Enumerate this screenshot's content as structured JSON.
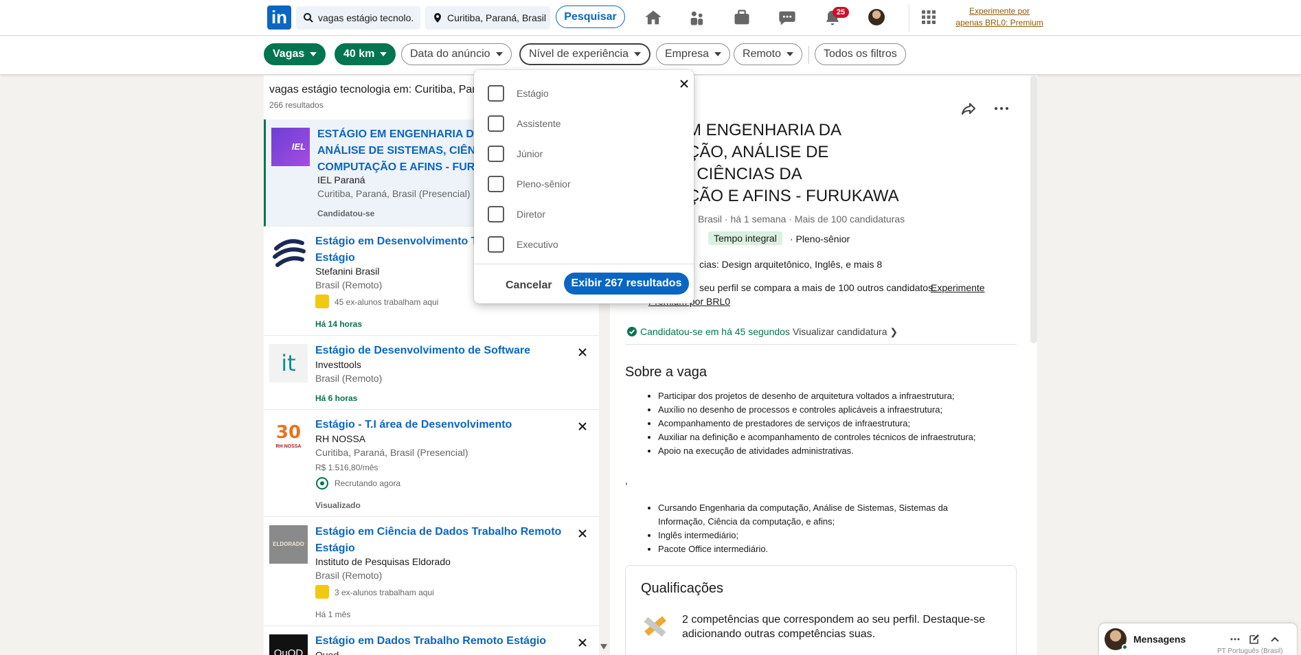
{
  "nav": {
    "search_query": "vagas estágio tecnolo...",
    "location": "Curitiba, Paraná, Brasil",
    "search_button": "Pesquisar",
    "notifications_count": "25",
    "premium_line1": "Experimente por",
    "premium_line2": "apenas BRL0: Premium",
    "logo_text": "in"
  },
  "filters": {
    "vagas": "Vagas",
    "distance": "40 km",
    "date": "Data do anúncio",
    "experience": "Nível de experiência",
    "company": "Empresa",
    "remote": "Remoto",
    "all": "Todos os filtros"
  },
  "results": {
    "heading": "vagas estágio tecnologia em: Curitiba, Paraná",
    "count": "266 resultados",
    "jobs": [
      {
        "title": "ESTÁGIO EM ENGENHARIA DA COMPUTAÇÃO, ANÁLISE DE SISTEMAS, CIÊNCIAS DA COMPUTAÇÃO E AFINS - FURUKAWA",
        "company": "IEL Paraná",
        "location": "Curitiba, Paraná, Brasil (Presencial)",
        "meta": "",
        "footer": "Candidatou-se"
      },
      {
        "title": "Estágio em Desenvolvimento Trabalho Remoto Estágio",
        "company": "Stefanini Brasil",
        "location": "Brasil (Remoto)",
        "meta": "45 ex-alunos trabalham aqui",
        "footer": "Há 14 horas"
      },
      {
        "title": "Estágio de Desenvolvimento de Software",
        "company": "Investtools",
        "location": "Brasil (Remoto)",
        "meta": "",
        "footer": "Há 6 horas"
      },
      {
        "title": "Estágio - T.I área de Desenvolvimento",
        "company": "RH NOSSA",
        "location": "Curitiba, Paraná, Brasil (Presencial)",
        "salary": "R$ 1.516,80/mês",
        "meta": "Recrutando agora",
        "footer": "Visualizado"
      },
      {
        "title": "Estágio em Ciência de Dados Trabalho Remoto Estágio",
        "company": "Instituto de Pesquisas Eldorado",
        "location": "Brasil (Remoto)",
        "meta": "3 ex-alunos trabalham aqui",
        "footer": "Há 1 mês"
      },
      {
        "title": "Estágio em Dados Trabalho Remoto Estágio",
        "company": "Quod",
        "location": "",
        "meta": "",
        "footer": ""
      }
    ]
  },
  "logos": {
    "iel": "IEL",
    "it": "it",
    "rh": "RH NOSSA",
    "eldorado": "ELDORADO",
    "quod": "QuOD"
  },
  "detail": {
    "company_fragment": "á",
    "title_lines": [
      "EM ENGENHARIA DA",
      "AÇÃO, ANÁLISE DE",
      "S, CIÊNCIAS DA",
      "AÇÃO E AFINS - FURUKAWA"
    ],
    "meta": "Brasil · há 1 semana · Mais de 100 candidaturas",
    "tag_full_time": "Tempo integral",
    "level": "· Pleno-sênior",
    "skills": "cias: Design arquitetônico, Inglês, e mais 8",
    "compare_text": "seu perfil se compara a mais de 100 outros candidatos.",
    "compare_link1": "Experimente",
    "compare_link2": "Premium por BRL0",
    "applied": "Candidatou-se em há 45 segundos",
    "view_application": "Visualizar candidatura",
    "about_heading": "Sobre a vaga",
    "bullets1": [
      "Participar dos projetos de desenho de arquitetura voltados a infraestrutura;",
      "Auxílio no desenho de processos e controles aplicáveis a infraestrutura;",
      "Acompanhamento de prestadores de serviços de infraestrutura;",
      "Auxiliar na definição e acompanhamento de controles técnicos de infraestrutura;",
      "Apoio na execução de atividades administrativas."
    ],
    "stray": ",",
    "bullets2": [
      "Cursando Engenharia da computação, Análise de Sistemas, Sistemas da Informação, Ciência da computação, e afins;",
      "Inglês intermediário;",
      "Pacote Office intermediário."
    ],
    "qual_heading": "Qualificações",
    "qual_text": "2 competências que correspondem ao seu perfil. Destaque-se adicionando outras competências suas."
  },
  "dropdown": {
    "options": [
      "Estágio",
      "Assistente",
      "Júnior",
      "Pleno-sênior",
      "Diretor",
      "Executivo"
    ],
    "cancel": "Cancelar",
    "show": "Exibir 267 resultados"
  },
  "messaging": {
    "label": "Mensagens",
    "footer_lang": "PT Português (Brasil)"
  }
}
